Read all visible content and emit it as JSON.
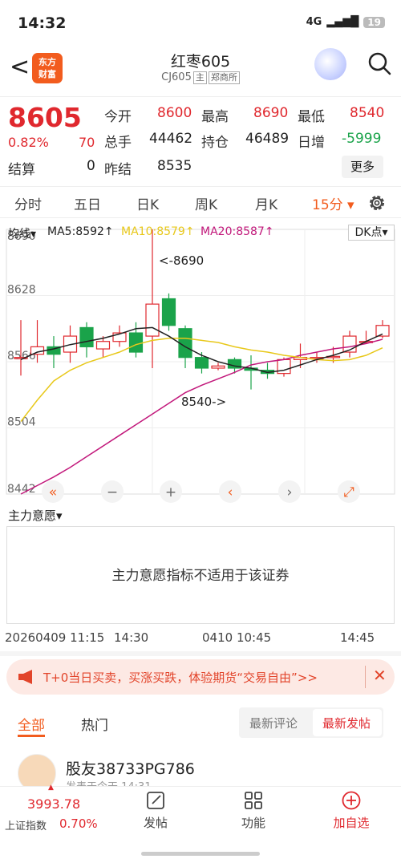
{
  "status_bar": {
    "time": "14:32",
    "signal": "4G",
    "battery": "19"
  },
  "header": {
    "back_glyph": "<",
    "logo_line1": "东方",
    "logo_line2": "财富",
    "title": "红枣605",
    "code": "CJ605",
    "tag_main": "主",
    "tag_exchange": "郑商所",
    "search_icon": "search-icon"
  },
  "quote": {
    "price": "8605",
    "change_pct": "0.82%",
    "change": "70",
    "settle_label": "结算",
    "settle": "0",
    "open_label": "今开",
    "open": "8600",
    "high_label": "最高",
    "high": "8690",
    "low_label": "最低",
    "low": "8540",
    "volume_label": "总手",
    "volume": "44462",
    "position_label": "持仓",
    "position": "46489",
    "daily_inc_label": "日增",
    "daily_inc": "-5999",
    "prev_settle_label": "昨结",
    "prev_settle": "8535",
    "more_label": "更多"
  },
  "periods": [
    {
      "label": "分时"
    },
    {
      "label": "五日"
    },
    {
      "label": "日K"
    },
    {
      "label": "周K"
    },
    {
      "label": "月K"
    },
    {
      "label": "15分"
    }
  ],
  "ma": {
    "label": "均线",
    "ma5": "MA5:8592↑",
    "ma10": "MA10:8579↑",
    "ma20": "MA20:8587↑",
    "dk": "DK点",
    "ma5_color": "#222222",
    "ma10_color": "#e8c81a",
    "ma20_color": "#c2187b"
  },
  "chart_data": {
    "type": "candlestick",
    "y_ticks": [
      "8690",
      "8628",
      "8566",
      "8504",
      "8442"
    ],
    "ylim": [
      8442,
      8690
    ],
    "annotations": {
      "high": "<-8690",
      "low": "8540->"
    },
    "candles": [
      {
        "o": 8570,
        "h": 8605,
        "l": 8553,
        "c": 8570
      },
      {
        "o": 8573,
        "h": 8605,
        "l": 8565,
        "c": 8580
      },
      {
        "o": 8580,
        "h": 8590,
        "l": 8560,
        "c": 8573
      },
      {
        "o": 8575,
        "h": 8600,
        "l": 8565,
        "c": 8590
      },
      {
        "o": 8598,
        "h": 8603,
        "l": 8570,
        "c": 8580
      },
      {
        "o": 8578,
        "h": 8590,
        "l": 8570,
        "c": 8585
      },
      {
        "o": 8585,
        "h": 8600,
        "l": 8580,
        "c": 8593
      },
      {
        "o": 8593,
        "h": 8603,
        "l": 8570,
        "c": 8575
      },
      {
        "o": 8590,
        "h": 8690,
        "l": 8560,
        "c": 8620
      },
      {
        "o": 8625,
        "h": 8630,
        "l": 8595,
        "c": 8600
      },
      {
        "o": 8597,
        "h": 8600,
        "l": 8560,
        "c": 8570
      },
      {
        "o": 8570,
        "h": 8575,
        "l": 8555,
        "c": 8560
      },
      {
        "o": 8560,
        "h": 8565,
        "l": 8558,
        "c": 8562
      },
      {
        "o": 8568,
        "h": 8570,
        "l": 8555,
        "c": 8560
      },
      {
        "o": 8560,
        "h": 8572,
        "l": 8540,
        "c": 8558
      },
      {
        "o": 8558,
        "h": 8565,
        "l": 8550,
        "c": 8555
      },
      {
        "o": 8555,
        "h": 8570,
        "l": 8552,
        "c": 8568
      },
      {
        "o": 8568,
        "h": 8583,
        "l": 8560,
        "c": 8570
      },
      {
        "o": 8570,
        "h": 8575,
        "l": 8565,
        "c": 8570
      },
      {
        "o": 8570,
        "h": 8580,
        "l": 8565,
        "c": 8571
      },
      {
        "o": 8575,
        "h": 8595,
        "l": 8570,
        "c": 8590
      },
      {
        "o": 8585,
        "h": 8595,
        "l": 8583,
        "c": 8585
      },
      {
        "o": 8590,
        "h": 8605,
        "l": 8588,
        "c": 8600
      }
    ],
    "ma5": [
      8568,
      8575,
      8578,
      8582,
      8585,
      8588,
      8592,
      8597,
      8598,
      8590,
      8580,
      8572,
      8566,
      8562,
      8560,
      8556,
      8558,
      8563,
      8568,
      8572,
      8577,
      8585,
      8592
    ],
    "ma10": [
      8510,
      8530,
      8548,
      8558,
      8565,
      8570,
      8575,
      8582,
      8586,
      8588,
      8588,
      8586,
      8584,
      8580,
      8577,
      8575,
      8572,
      8570,
      8568,
      8567,
      8568,
      8572,
      8579
    ],
    "ma20": [
      8442,
      8450,
      8458,
      8467,
      8477,
      8487,
      8497,
      8507,
      8517,
      8527,
      8537,
      8544,
      8550,
      8556,
      8563,
      8566,
      8568,
      8572,
      8575,
      8578,
      8580,
      8583,
      8587
    ]
  },
  "chart_controls": [
    "«",
    "−",
    "+",
    "‹",
    "›",
    "⤢"
  ],
  "sub_indicator": {
    "label": "主力意愿",
    "message": "主力意愿指标不适用于该证券"
  },
  "time_axis": {
    "t1": "20260409 11:15",
    "t2": "14:30",
    "t3": "0410 10:45",
    "t4": "14:45"
  },
  "promo": {
    "text": "T+0当日买卖，买涨买跌，体验期货“交易自由”>>"
  },
  "comment_tabs": {
    "all": "全部",
    "hot": "热门",
    "latest_comment": "最新评论",
    "latest_post": "最新发帖"
  },
  "post": {
    "author": "股友38733PG786",
    "meta": "发表于今天 14:31"
  },
  "bottom_nav": {
    "index_value": "3993.78",
    "index_name": "上证指数",
    "index_pct": "0.70%",
    "post_label": "发帖",
    "func_label": "功能",
    "add_label": "加自选"
  }
}
